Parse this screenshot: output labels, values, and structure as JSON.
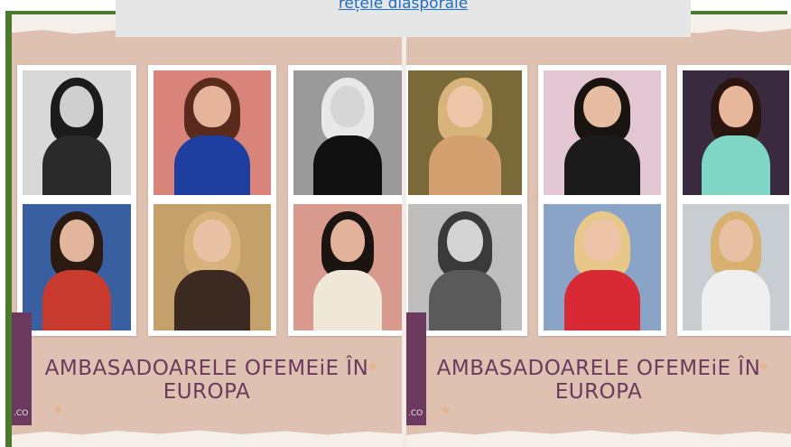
{
  "overlay": {
    "link_text": "rețele diasporale"
  },
  "panels": [
    {
      "tagline": "AMBASADOARELE OFEMEiE ÎN EUROPA",
      "flag_text": ".CO",
      "photos": [
        {
          "bg": "#d8d8d8",
          "hair": "#1b1b1b",
          "body": "#2a2a2a",
          "skin": "#cfcfcf"
        },
        {
          "bg": "#d8847a",
          "hair": "#5a2a1c",
          "body": "#1f3fa0",
          "skin": "#e6b49a"
        },
        {
          "bg": "#9a9a9a",
          "hair": "#e8e8e8",
          "body": "#111111",
          "skin": "#d6d6d6"
        },
        {
          "bg": "#3a5fa0",
          "hair": "#2b1a12",
          "body": "#c83a2e",
          "skin": "#e2b59c"
        },
        {
          "bg": "#c4a06a",
          "hair": "#d8b27a",
          "body": "#3a2a22",
          "skin": "#e8c2a4"
        },
        {
          "bg": "#d89a8c",
          "hair": "#1c1410",
          "body": "#efe8d8",
          "skin": "#e2b39a"
        }
      ]
    },
    {
      "tagline": "AMBASADOARELE OFEMEiE ÎN EUROPA",
      "flag_text": ".CO",
      "photos": [
        {
          "bg": "#7a6a3a",
          "hair": "#d6b47a",
          "body": "#d4a070",
          "skin": "#ecc6a8"
        },
        {
          "bg": "#e2c6d2",
          "hair": "#1a1410",
          "body": "#1b1b1b",
          "skin": "#e6bca2"
        },
        {
          "bg": "#3a2a40",
          "hair": "#2a160e",
          "body": "#7fd6c4",
          "skin": "#e8b69a"
        },
        {
          "bg": "#bdbdbd",
          "hair": "#3a3a3a",
          "body": "#5a5a5a",
          "skin": "#d4d4d4"
        },
        {
          "bg": "#8aa4c8",
          "hair": "#e8c88a",
          "body": "#d82a34",
          "skin": "#ecc3a6"
        },
        {
          "bg": "#c8cdd2",
          "hair": "#d8b070",
          "body": "#efefef",
          "skin": "#e8c0a4"
        }
      ]
    }
  ],
  "colors": {
    "frame_green": "#4a7a2c",
    "panel_pink": "#dfc1b2",
    "title_purple": "#6b3a5e",
    "link_blue": "#1f6fc6"
  }
}
